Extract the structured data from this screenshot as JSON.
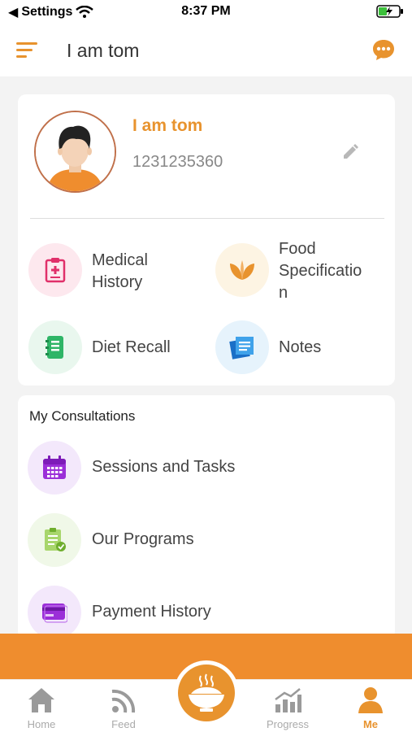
{
  "status": {
    "back_label": "Settings",
    "time": "8:37 PM"
  },
  "header": {
    "title": "I am  tom"
  },
  "profile": {
    "name": "I am  tom",
    "phone": "1231235360"
  },
  "grid": [
    {
      "label_lines": [
        "Medical",
        "History"
      ]
    },
    {
      "label_lines": [
        "Food",
        "Specificatio",
        "n"
      ]
    },
    {
      "label_lines": [
        "Diet Recall"
      ]
    },
    {
      "label_lines": [
        "Notes"
      ]
    }
  ],
  "consultations": {
    "title": "My Consultations",
    "items": [
      {
        "label": "Sessions and Tasks"
      },
      {
        "label": "Our Programs"
      },
      {
        "label": "Payment History"
      }
    ]
  },
  "nav": [
    {
      "label": "Home"
    },
    {
      "label": "Feed"
    },
    {
      "label": "Progress"
    },
    {
      "label": "Me"
    }
  ],
  "colors": {
    "accent": "#e8932e",
    "banner": "#ef8d2e"
  }
}
